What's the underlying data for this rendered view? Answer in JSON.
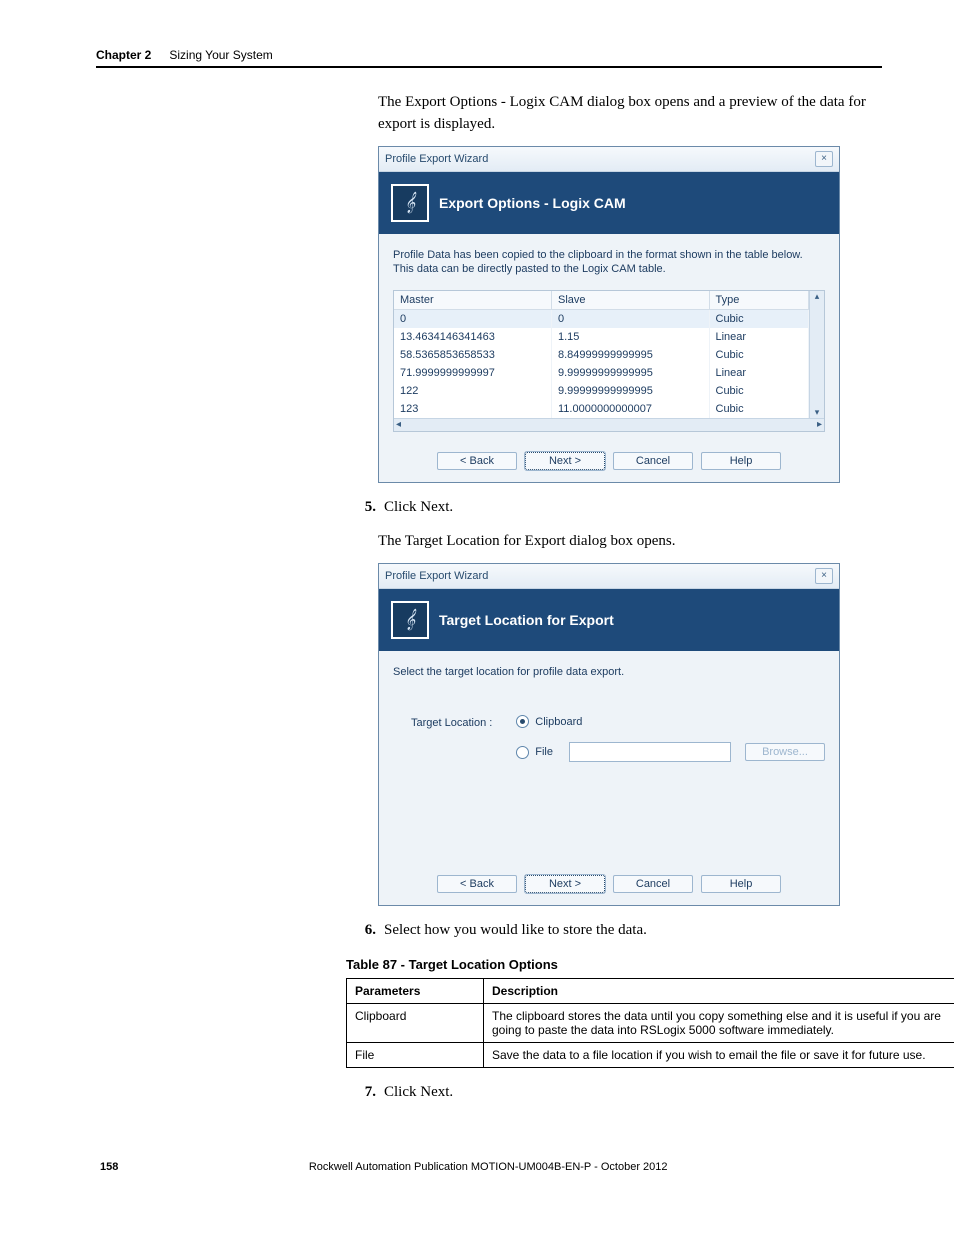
{
  "header": {
    "chapter_label": "Chapter 2",
    "section_title": "Sizing Your System"
  },
  "intro_para": "The Export Options - Logix CAM dialog box opens and a preview of the data for export is displayed.",
  "dialog1": {
    "window_title": "Profile Export Wizard",
    "banner_title": "Export Options - Logix CAM",
    "instruction": "Profile Data has been copied to the clipboard in the format shown in the table below. This data can be directly pasted to the Logix CAM table.",
    "columns": [
      "Master",
      "Slave",
      "Type"
    ],
    "rows": [
      {
        "master": "0",
        "slave": "0",
        "type": "Cubic",
        "hl": true
      },
      {
        "master": "13.4634146341463",
        "slave": "1.15",
        "type": "Linear"
      },
      {
        "master": "58.5365853658533",
        "slave": "8.84999999999995",
        "type": "Cubic"
      },
      {
        "master": "71.9999999999997",
        "slave": "9.99999999999995",
        "type": "Linear"
      },
      {
        "master": "122",
        "slave": "9.99999999999995",
        "type": "Cubic"
      },
      {
        "master": "123",
        "slave": "11.0000000000007",
        "type": "Cubic"
      }
    ],
    "buttons": {
      "back": "< Back",
      "next": "Next >",
      "cancel": "Cancel",
      "help": "Help"
    }
  },
  "step5": {
    "num": "5.",
    "text": "Click Next."
  },
  "after5_para": "The Target Location for Export dialog box opens.",
  "dialog2": {
    "window_title": "Profile Export Wizard",
    "banner_title": "Target Location for Export",
    "instruction": "Select the target location for profile data export.",
    "label_target": "Target Location :",
    "opt_clipboard": "Clipboard",
    "opt_file": "File",
    "browse": "Browse...",
    "buttons": {
      "back": "< Back",
      "next": "Next >",
      "cancel": "Cancel",
      "help": "Help"
    }
  },
  "step6": {
    "num": "6.",
    "text": "Select how you would like to store the data."
  },
  "table87": {
    "caption": "Table 87 - Target Location Options",
    "headers": {
      "param": "Parameters",
      "desc": "Description"
    },
    "rows": [
      {
        "param": "Clipboard",
        "desc": "The clipboard stores the data until you copy something else and it is useful if you are going to paste the data into RSLogix 5000 software immediately."
      },
      {
        "param": "File",
        "desc": "Save the data to a file location if you wish to email the file or save it for future use."
      }
    ]
  },
  "step7": {
    "num": "7.",
    "text": "Click Next."
  },
  "footer": {
    "page_num": "158",
    "pub": "Rockwell Automation Publication MOTION-UM004B-EN-P - October 2012"
  }
}
